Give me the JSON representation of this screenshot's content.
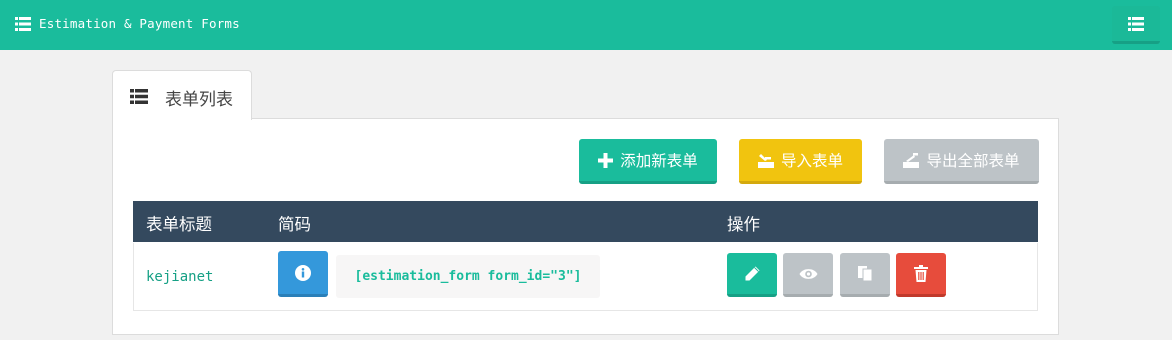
{
  "app": {
    "title": "Estimation & Payment Forms",
    "header_icon": "list-icon",
    "menu_icon": "list-icon"
  },
  "tabs": [
    {
      "label": "表单列表",
      "icon": "list-icon",
      "active": true
    }
  ],
  "toolbar": {
    "add_label": "添加新表单",
    "import_label": "导入表单",
    "export_label": "导出全部表单"
  },
  "table": {
    "columns": [
      "表单标题",
      "简码",
      "操作"
    ],
    "rows": [
      {
        "title": "kejianet",
        "shortcode": "[estimation_form form_id=\"3\"]",
        "actions": [
          "edit-icon",
          "view-icon",
          "copy-icon",
          "delete-icon"
        ]
      }
    ]
  },
  "colors": {
    "accent": "#1abc9c",
    "header_dark": "#34495e",
    "warning": "#f1c40f",
    "muted": "#bdc3c7",
    "info": "#3498db",
    "danger": "#e74c3c"
  }
}
